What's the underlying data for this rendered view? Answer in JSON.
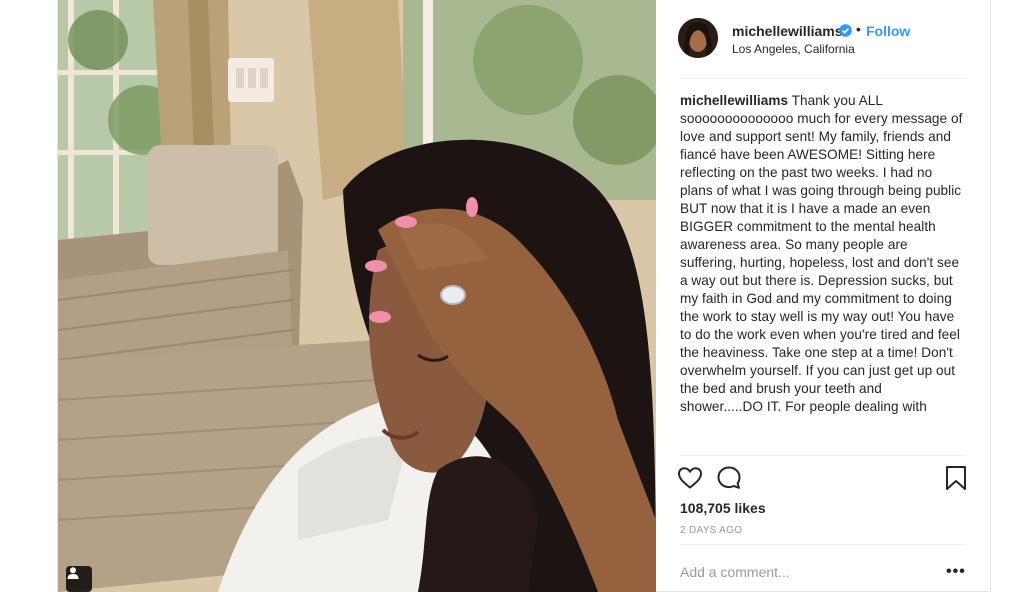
{
  "post": {
    "username": "michellewilliams",
    "follow_label": "Follow",
    "separator": "•",
    "location": "Los Angeles, California",
    "caption_user": "michellewilliams",
    "caption_text": " Thank you ALL soooooooooooooo much for every message of love and support sent! My family, friends and fiancé have been AWESOME! Sitting here reflecting on the past two weeks. I had no plans of what I was going through being public BUT now that it is I have a made an even BIGGER commitment to the mental health awareness area. So many people are suffering, hurting, hopeless, lost and don't see a way out but there is. Depression sucks, but my faith in God and my commitment to doing the work to stay well is my way out! You have to do the work even when you're tired and feel the heaviness. Take one step at a time! Don't overwhelm yourself. If you can just get up out the bed and brush your teeth and shower.....DO IT. For people dealing with",
    "likes": "108,705 likes",
    "date": "2 DAYS AGO",
    "comment_placeholder": "Add a comment...",
    "more_label": "•••"
  },
  "icons": {
    "photo_badge": "user-tag-icon",
    "verified": "verified-badge-icon",
    "like": "heart-icon",
    "comment": "comment-bubble-icon",
    "save": "bookmark-icon"
  },
  "colors": {
    "link_blue": "#3897f0",
    "text": "#262626",
    "muted": "#999999",
    "divider": "#efefef"
  }
}
